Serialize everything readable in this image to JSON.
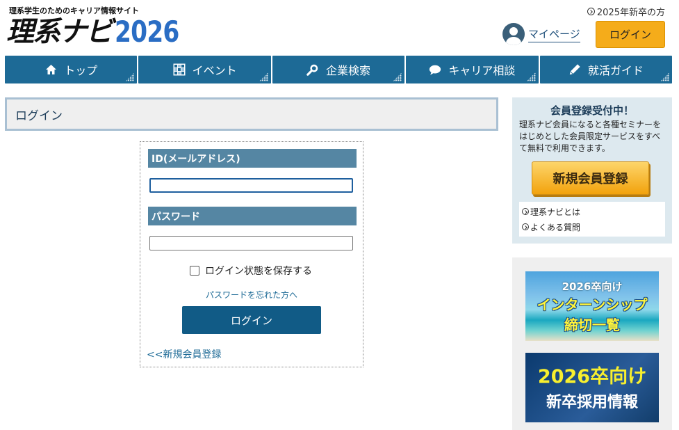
{
  "header": {
    "tagline": "理系学生のためのキャリア情報サイト",
    "logo_main": "理系ナビ",
    "logo_year": "2026",
    "grad_link": "2025年新卒の方",
    "mypage_label": "マイページ",
    "login_label": "ログイン"
  },
  "nav": {
    "items": [
      {
        "label": "トップ",
        "icon": "home-icon"
      },
      {
        "label": "イベント",
        "icon": "calendar-icon"
      },
      {
        "label": "企業検索",
        "icon": "search-icon"
      },
      {
        "label": "キャリア相談",
        "icon": "speech-bubble-icon"
      },
      {
        "label": "就活ガイド",
        "icon": "pencil-icon"
      }
    ],
    "color": "#1d6a96"
  },
  "main": {
    "page_title": "ログイン",
    "id_label": "ID(メールアドレス)",
    "id_value": "",
    "password_label": "パスワード",
    "password_value": "",
    "remember_label": "ログイン状態を保存する",
    "remember_checked": false,
    "forgot_link": "パスワードを忘れた方へ",
    "submit_label": "ログイン",
    "register_link": "<<新規会員登録"
  },
  "sidebar": {
    "reg_title": "会員登録受付中！",
    "reg_desc": "理系ナビ会員になると各種セミナーをはじめとした会員限定サービスをすべて無料で利用できます。",
    "reg_button": "新規会員登録",
    "links": [
      "理系ナビとは",
      "よくある質問"
    ],
    "banner1": {
      "line1": "2026卒向け",
      "line2": "インターンシップ",
      "line3": "締切一覧"
    },
    "banner2": {
      "line1": "2026卒向け",
      "line2": "新卒採用情報"
    }
  },
  "colors": {
    "accent_orange": "#f5ac1a",
    "brand_blue": "#2a6dc4",
    "field_header": "#5586a3"
  }
}
